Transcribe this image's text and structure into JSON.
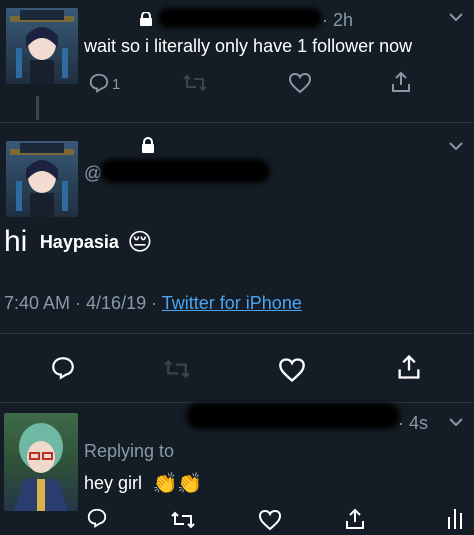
{
  "tweet1": {
    "time": "· 2h",
    "text": "wait so i literally only have 1 follower now",
    "reply_count": "1"
  },
  "main_tweet": {
    "handle_partial": "@",
    "text_prefix": "hi",
    "text_name": "Haypasia",
    "emoji": "😔",
    "timestamp": "7:40 AM · 4/16/19 ·",
    "client": "Twitter for iPhone"
  },
  "reply_tweet": {
    "time": "· 4s",
    "replying_label": "Replying to",
    "text": "hey girl",
    "emoji": "👏👏"
  },
  "colors": {
    "background": "#141d26",
    "muted": "#8899a6",
    "link": "#4aa5f0"
  }
}
